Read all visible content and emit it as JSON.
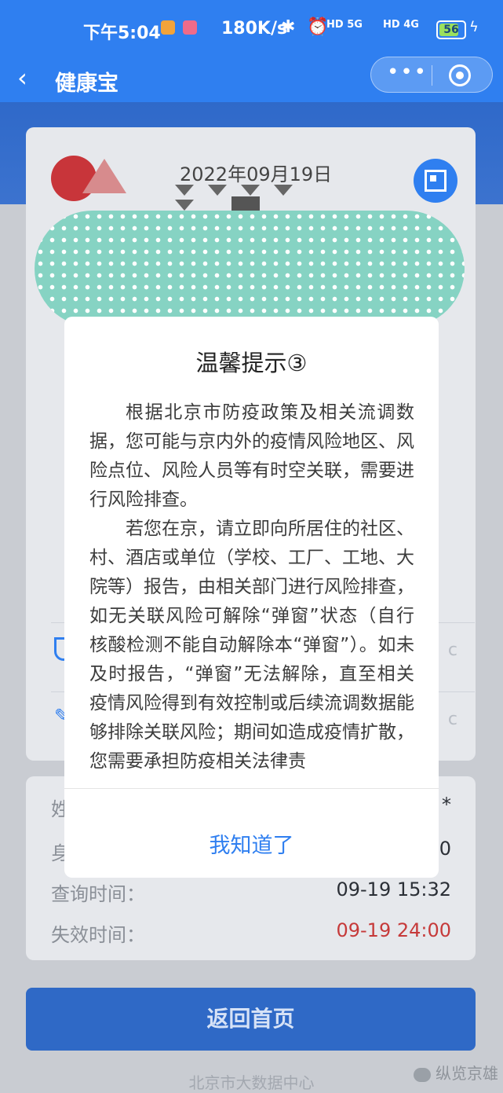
{
  "status_bar": {
    "time": "下午5:04",
    "net_speed": "180K/s",
    "icons": "✱ ⏰",
    "sig1": "HD 5G",
    "sig2": "HD 4G",
    "battery": "56"
  },
  "nav": {
    "back_icon": "‹",
    "title": "健康宝",
    "more_icon": "•••"
  },
  "card": {
    "date": "2022年09月19日"
  },
  "modal": {
    "title": "温馨提示③",
    "paragraph_1": "根据北京市防疫政策及相关流调数据，您可能与京内外的疫情风险地区、风险点位、风险人员等有时空关联，需要进行风险排查。",
    "paragraph_2": "若您在京，请立即向所居住的社区、村、酒店或单位（学校、工厂、工地、大院等）报告，由相关部门进行风险排查，如无关联风险可解除“弹窗”状态（自行核酸检测不能自动解除本“弹窗”）。如未及时报告，“弹窗”无法解除，直至相关疫情风险得到有效控制或后续流调数据能够排除关联风险；期间如造成疫情扩散，您需要承担防疫相关法律责",
    "button": "我知道了"
  },
  "info": {
    "row1_label": "姓",
    "row1_value": "*",
    "row2_label": "身",
    "row2_value": "0",
    "query_label": "查询时间：",
    "query_value": "09-19 15:32",
    "expire_label": "失效时间：",
    "expire_value": "09-19 24:00"
  },
  "bottom": {
    "home_button": "返回首页",
    "footer": "北京市大数据中心",
    "watermark": "纵览京雄"
  },
  "faint_marks": {
    "row_a": "c",
    "row_b": "c"
  },
  "colors": {
    "brand_blue": "#2f7ff0",
    "expire_red": "#c63a3a",
    "blob_teal": "#86d3c3"
  }
}
